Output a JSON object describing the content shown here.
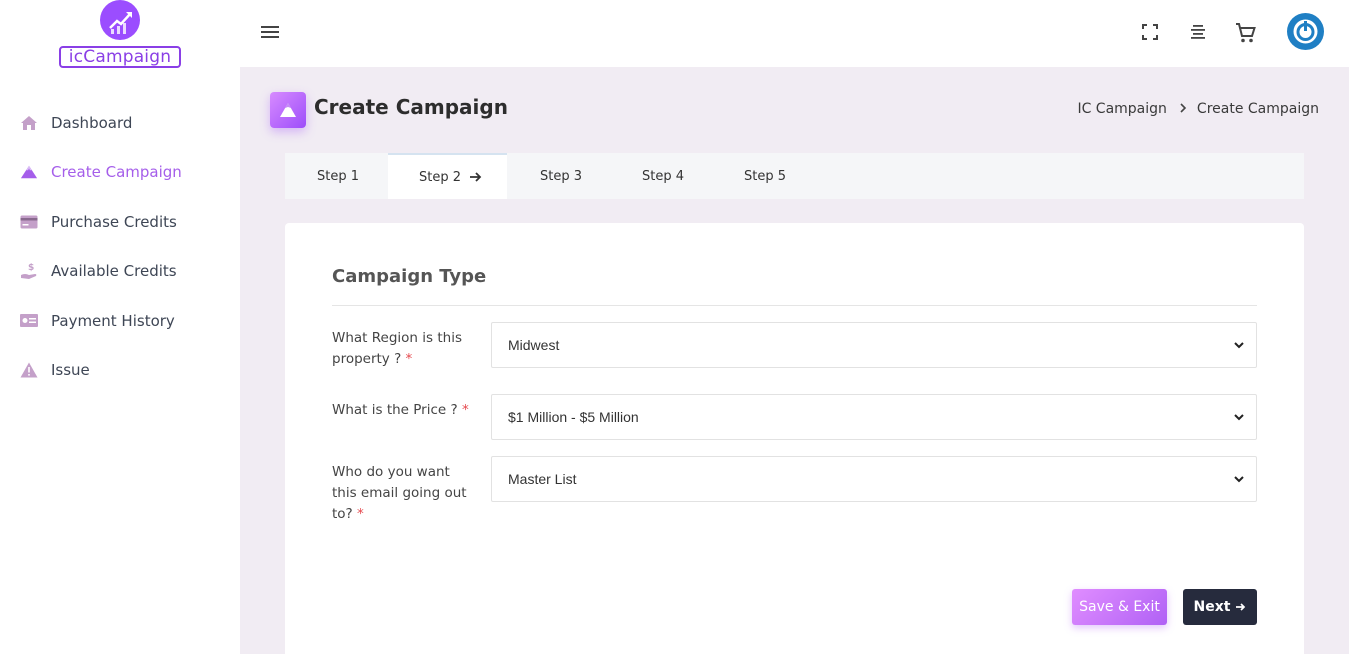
{
  "logo": {
    "text": "icCampaign"
  },
  "sidebar": {
    "items": [
      {
        "label": "Dashboard",
        "icon": "home-icon"
      },
      {
        "label": "Create Campaign",
        "icon": "mountain-icon",
        "active": true
      },
      {
        "label": "Purchase Credits",
        "icon": "credit-card-icon"
      },
      {
        "label": "Available Credits",
        "icon": "hand-coin-icon"
      },
      {
        "label": "Payment History",
        "icon": "money-bill-icon"
      },
      {
        "label": "Issue",
        "icon": "warning-icon"
      }
    ]
  },
  "page": {
    "title": "Create Campaign",
    "breadcrumb": [
      "IC Campaign",
      "Create Campaign"
    ]
  },
  "steps": [
    {
      "label": "Step 1"
    },
    {
      "label": "Step 2",
      "active": true
    },
    {
      "label": "Step 3"
    },
    {
      "label": "Step 4"
    },
    {
      "label": "Step 5"
    }
  ],
  "form": {
    "title": "Campaign Type",
    "fields": [
      {
        "label": "What Region is this property ?",
        "value": "Midwest"
      },
      {
        "label": "What is the Price ?",
        "value": "$1 Million - $5 Million"
      },
      {
        "label": "Who do you want this email going out to?",
        "value": "Master List"
      }
    ],
    "required_mark": "*"
  },
  "buttons": {
    "save": "Save & Exit",
    "next": "Next"
  },
  "colors": {
    "accent": "#a55eea",
    "dark": "#262b3d",
    "avatar": "#1f7fc4"
  }
}
